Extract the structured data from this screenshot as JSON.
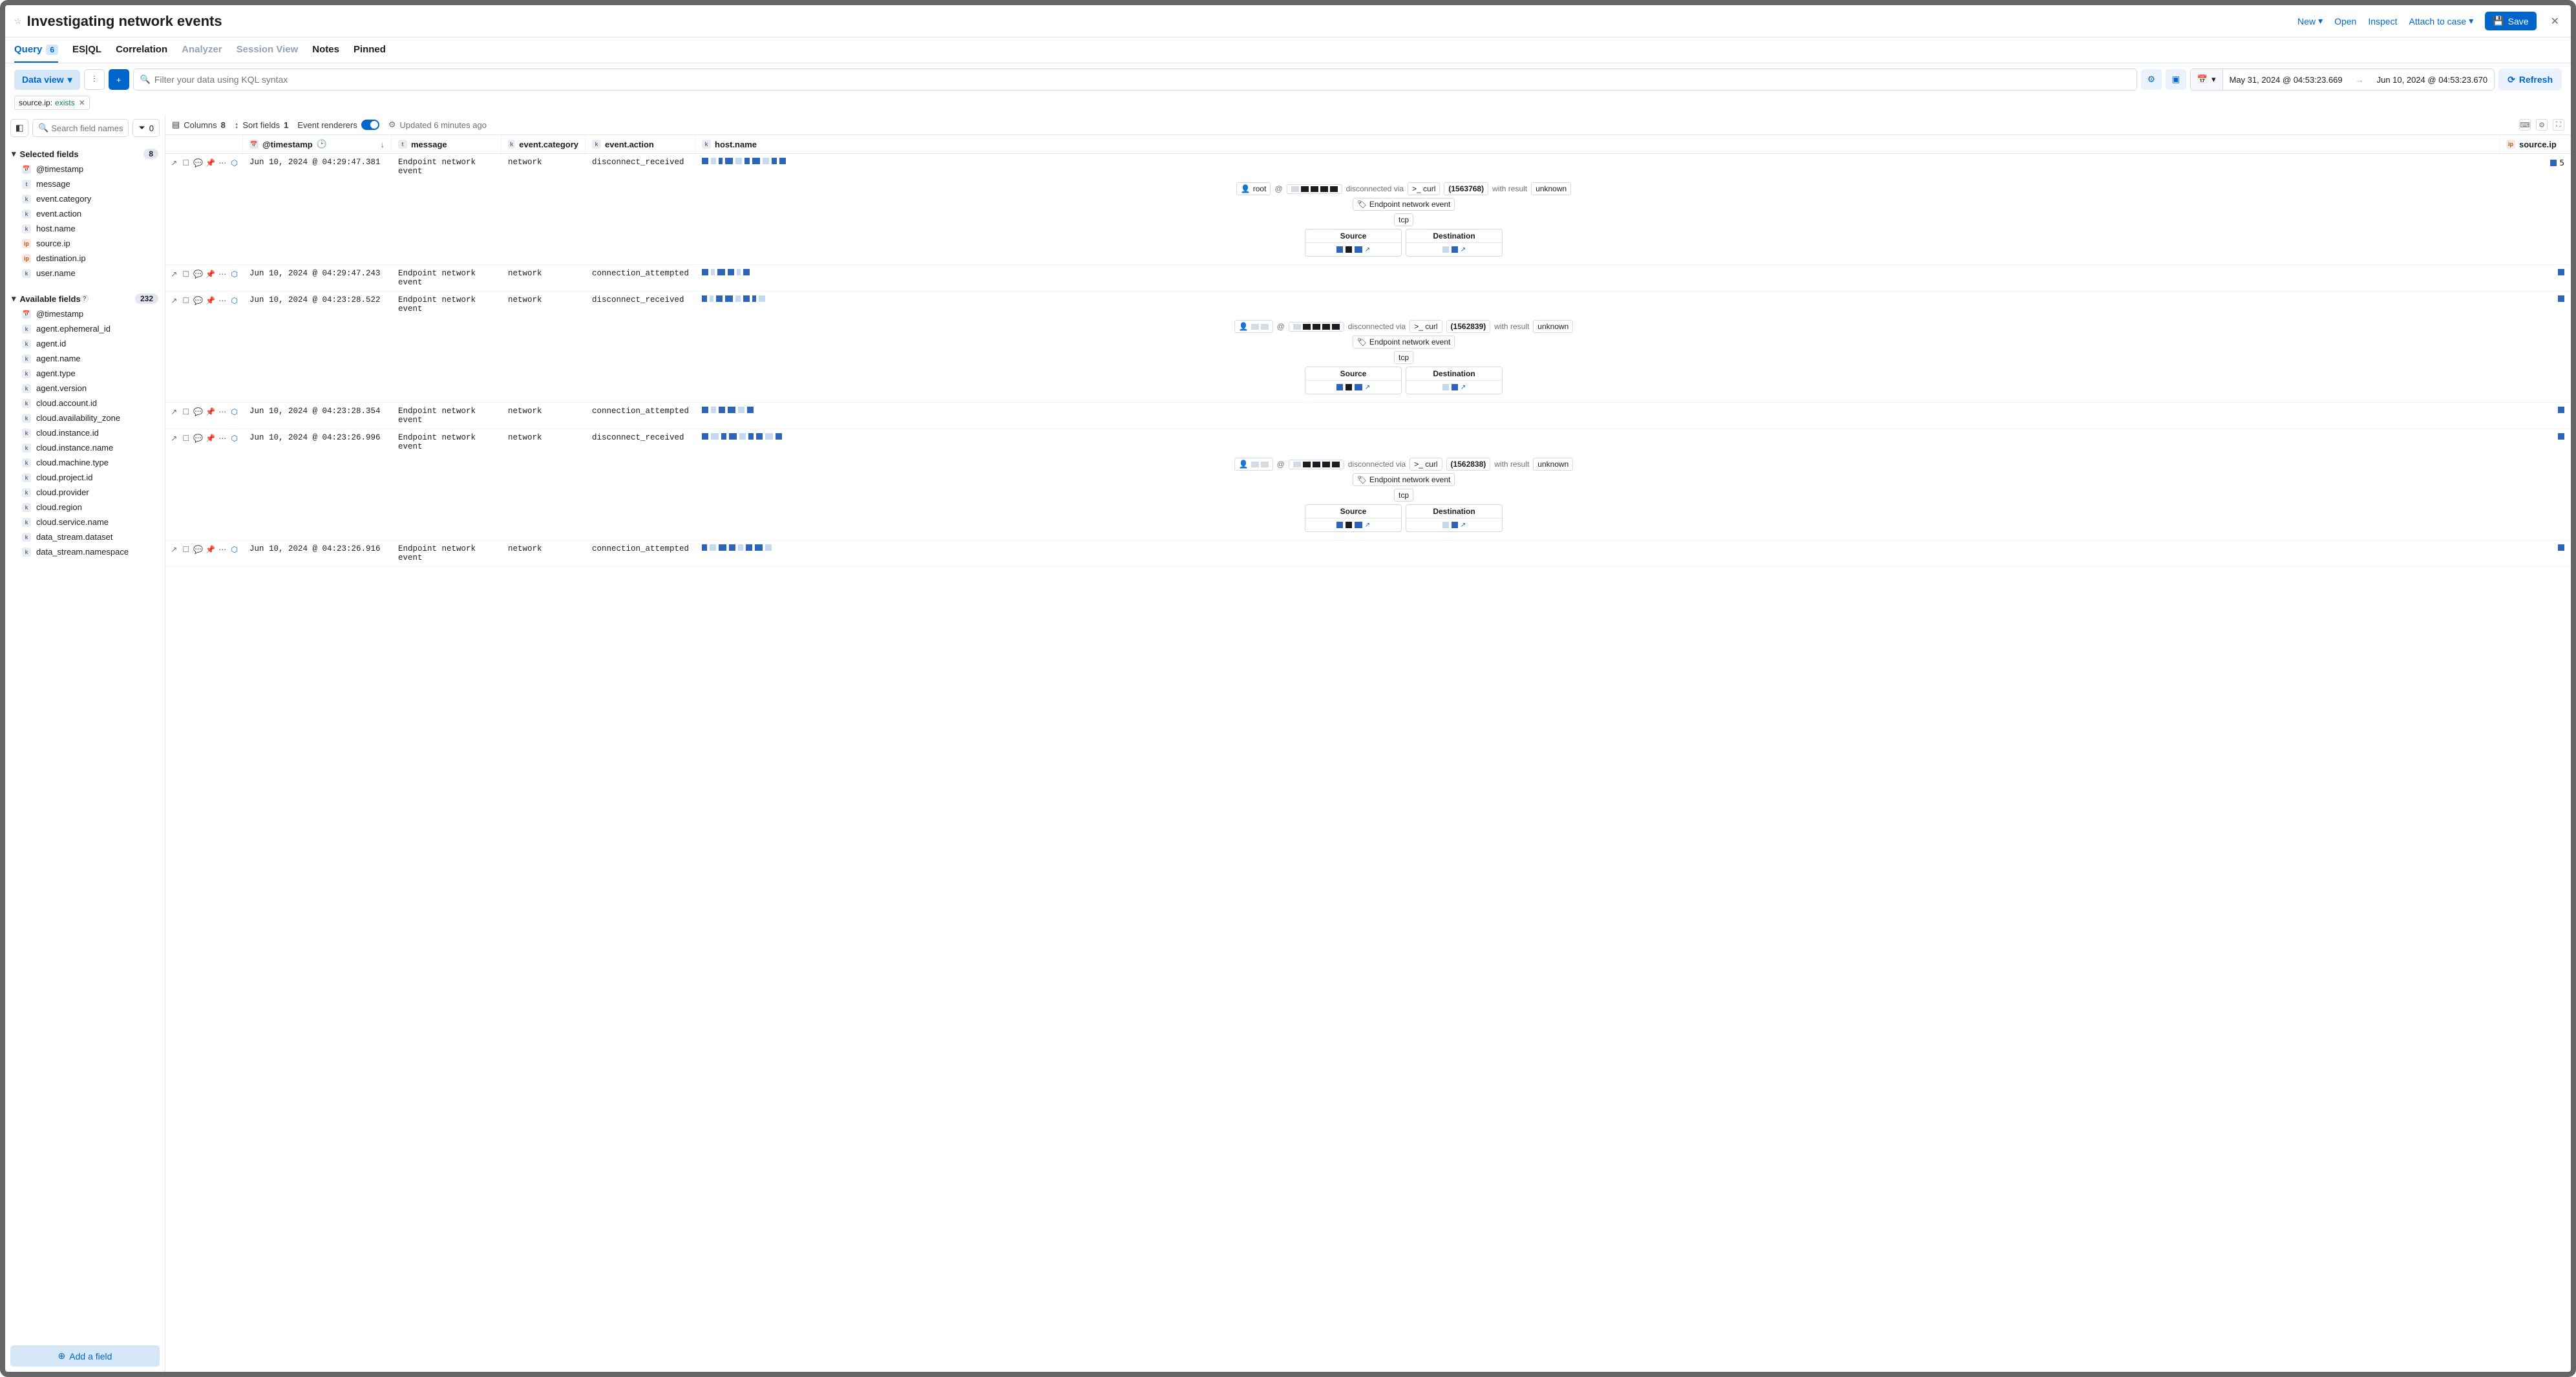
{
  "header": {
    "title": "Investigating network events",
    "new": "New",
    "open": "Open",
    "inspect": "Inspect",
    "attach": "Attach to case",
    "save": "Save"
  },
  "tabs": {
    "query": "Query",
    "query_count": "6",
    "esql": "ES|QL",
    "correlation": "Correlation",
    "analyzer": "Analyzer",
    "session": "Session View",
    "notes": "Notes",
    "pinned": "Pinned"
  },
  "querybar": {
    "dataview": "Data view",
    "search_placeholder": "Filter your data using KQL syntax",
    "date_from": "May 31, 2024 @ 04:53:23.669",
    "date_to": "Jun 10, 2024 @ 04:53:23.670",
    "refresh": "Refresh"
  },
  "filters": {
    "pill_field": "source.ip:",
    "pill_value": "exists"
  },
  "sidebar": {
    "search_placeholder": "Search field names",
    "filter_count": "0",
    "selected_label": "Selected fields",
    "selected_count": "8",
    "selected": [
      {
        "type": "date",
        "name": "@timestamp"
      },
      {
        "type": "text",
        "name": "message"
      },
      {
        "type": "kw",
        "name": "event.category"
      },
      {
        "type": "kw",
        "name": "event.action"
      },
      {
        "type": "kw",
        "name": "host.name"
      },
      {
        "type": "ip",
        "name": "source.ip"
      },
      {
        "type": "ip",
        "name": "destination.ip"
      },
      {
        "type": "kw",
        "name": "user.name"
      }
    ],
    "available_label": "Available fields",
    "available_count": "232",
    "available": [
      {
        "type": "date",
        "name": "@timestamp"
      },
      {
        "type": "kw",
        "name": "agent.ephemeral_id"
      },
      {
        "type": "kw",
        "name": "agent.id"
      },
      {
        "type": "kw",
        "name": "agent.name"
      },
      {
        "type": "kw",
        "name": "agent.type"
      },
      {
        "type": "kw",
        "name": "agent.version"
      },
      {
        "type": "kw",
        "name": "cloud.account.id"
      },
      {
        "type": "kw",
        "name": "cloud.availability_zone"
      },
      {
        "type": "kw",
        "name": "cloud.instance.id"
      },
      {
        "type": "kw",
        "name": "cloud.instance.name"
      },
      {
        "type": "kw",
        "name": "cloud.machine.type"
      },
      {
        "type": "kw",
        "name": "cloud.project.id"
      },
      {
        "type": "kw",
        "name": "cloud.provider"
      },
      {
        "type": "kw",
        "name": "cloud.region"
      },
      {
        "type": "kw",
        "name": "cloud.service.name"
      },
      {
        "type": "kw",
        "name": "data_stream.dataset"
      },
      {
        "type": "kw",
        "name": "data_stream.namespace"
      }
    ],
    "add_field": "Add a field"
  },
  "toolbar": {
    "columns_label": "Columns",
    "columns_count": "8",
    "sort_label": "Sort fields",
    "sort_count": "1",
    "renderers_label": "Event renderers",
    "updated": "Updated 6 minutes ago"
  },
  "columns": {
    "timestamp": "@timestamp",
    "message": "message",
    "event_category": "event.category",
    "event_action": "event.action",
    "host_name": "host.name",
    "source_ip": "source.ip"
  },
  "renderer_common": {
    "at": "@",
    "disconnected_via": "disconnected via",
    "with_result": "with result",
    "event_label": "Endpoint network event",
    "protocol": "tcp",
    "source": "Source",
    "destination": "Destination",
    "curl_prefix": ">_",
    "curl": "curl"
  },
  "rows": [
    {
      "ts": "Jun 10, 2024 @ 04:29:47.381",
      "msg": "Endpoint network event",
      "cat": "network",
      "act": "disconnect_received",
      "src_extra": "5",
      "expanded": true,
      "user": "root",
      "pid": "(1563768)",
      "result": "unknown"
    },
    {
      "ts": "Jun 10, 2024 @ 04:29:47.243",
      "msg": "Endpoint network event",
      "cat": "network",
      "act": "connection_attempted",
      "expanded": false
    },
    {
      "ts": "Jun 10, 2024 @ 04:23:28.522",
      "msg": "Endpoint network event",
      "cat": "network",
      "act": "disconnect_received",
      "expanded": true,
      "user": "",
      "pid": "(1562839)",
      "result": "unknown"
    },
    {
      "ts": "Jun 10, 2024 @ 04:23:28.354",
      "msg": "Endpoint network event",
      "cat": "network",
      "act": "connection_attempted",
      "expanded": false
    },
    {
      "ts": "Jun 10, 2024 @ 04:23:26.996",
      "msg": "Endpoint network event",
      "cat": "network",
      "act": "disconnect_received",
      "expanded": true,
      "user": "",
      "pid": "(1562838)",
      "result": "unknown"
    },
    {
      "ts": "Jun 10, 2024 @ 04:23:26.916",
      "msg": "Endpoint network event",
      "cat": "network",
      "act": "connection_attempted",
      "expanded": false
    }
  ]
}
